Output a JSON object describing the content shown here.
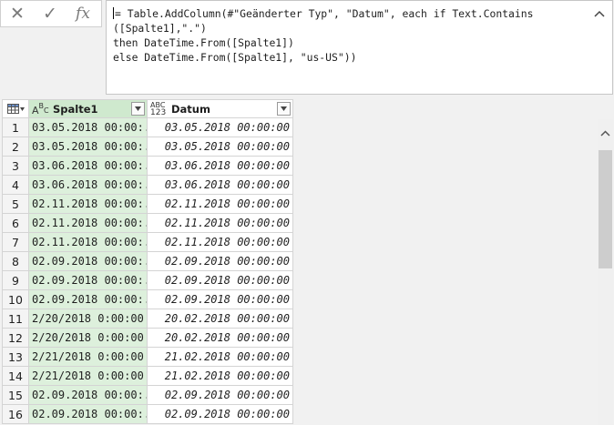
{
  "formula_bar": {
    "cancel_icon": "✕",
    "confirm_icon": "✓",
    "fx_icon": "fx",
    "lines": [
      "= Table.AddColumn(#\"Geänderter Typ\", \"Datum\", each if Text.Contains",
      "([Spalte1],\".\")",
      "then DateTime.From([Spalte1])",
      "else DateTime.From([Spalte1], \"us-US\"))"
    ],
    "collapse_icon": "chevron-up-icon"
  },
  "table": {
    "columns": [
      {
        "name": "Spalte1",
        "type_icon_top": "A",
        "type_icon_mid": "B",
        "type_icon_bot": "C"
      },
      {
        "name": "Datum",
        "type_icon_top": "ABC",
        "type_icon_bot": "123"
      }
    ],
    "rows": [
      {
        "n": "1",
        "spalte1": "03.05.2018 00:00:...",
        "datum": "03.05.2018 00:00:00"
      },
      {
        "n": "2",
        "spalte1": "03.05.2018 00:00:...",
        "datum": "03.05.2018 00:00:00"
      },
      {
        "n": "3",
        "spalte1": "03.06.2018 00:00:...",
        "datum": "03.06.2018 00:00:00"
      },
      {
        "n": "4",
        "spalte1": "03.06.2018 00:00:...",
        "datum": "03.06.2018 00:00:00"
      },
      {
        "n": "5",
        "spalte1": "02.11.2018 00:00:...",
        "datum": "02.11.2018 00:00:00"
      },
      {
        "n": "6",
        "spalte1": "02.11.2018 00:00:...",
        "datum": "02.11.2018 00:00:00"
      },
      {
        "n": "7",
        "spalte1": "02.11.2018 00:00:...",
        "datum": "02.11.2018 00:00:00"
      },
      {
        "n": "8",
        "spalte1": "02.09.2018 00:00:...",
        "datum": "02.09.2018 00:00:00"
      },
      {
        "n": "9",
        "spalte1": "02.09.2018 00:00:...",
        "datum": "02.09.2018 00:00:00"
      },
      {
        "n": "10",
        "spalte1": "02.09.2018 00:00:...",
        "datum": "02.09.2018 00:00:00"
      },
      {
        "n": "11",
        "spalte1": "2/20/2018 0:00:00",
        "datum": "20.02.2018 00:00:00"
      },
      {
        "n": "12",
        "spalte1": "2/20/2018 0:00:00",
        "datum": "20.02.2018 00:00:00"
      },
      {
        "n": "13",
        "spalte1": "2/21/2018 0:00:00",
        "datum": "21.02.2018 00:00:00"
      },
      {
        "n": "14",
        "spalte1": "2/21/2018 0:00:00",
        "datum": "21.02.2018 00:00:00"
      },
      {
        "n": "15",
        "spalte1": "02.09.2018 00:00:...",
        "datum": "02.09.2018 00:00:00"
      },
      {
        "n": "16",
        "spalte1": "02.09.2018 00:00:...",
        "datum": "02.09.2018 00:00:00"
      }
    ]
  },
  "colors": {
    "spalte1_column_bg": "#ddf0dc",
    "grid_border": "#d4d4d4",
    "background": "#f1f1f1"
  }
}
